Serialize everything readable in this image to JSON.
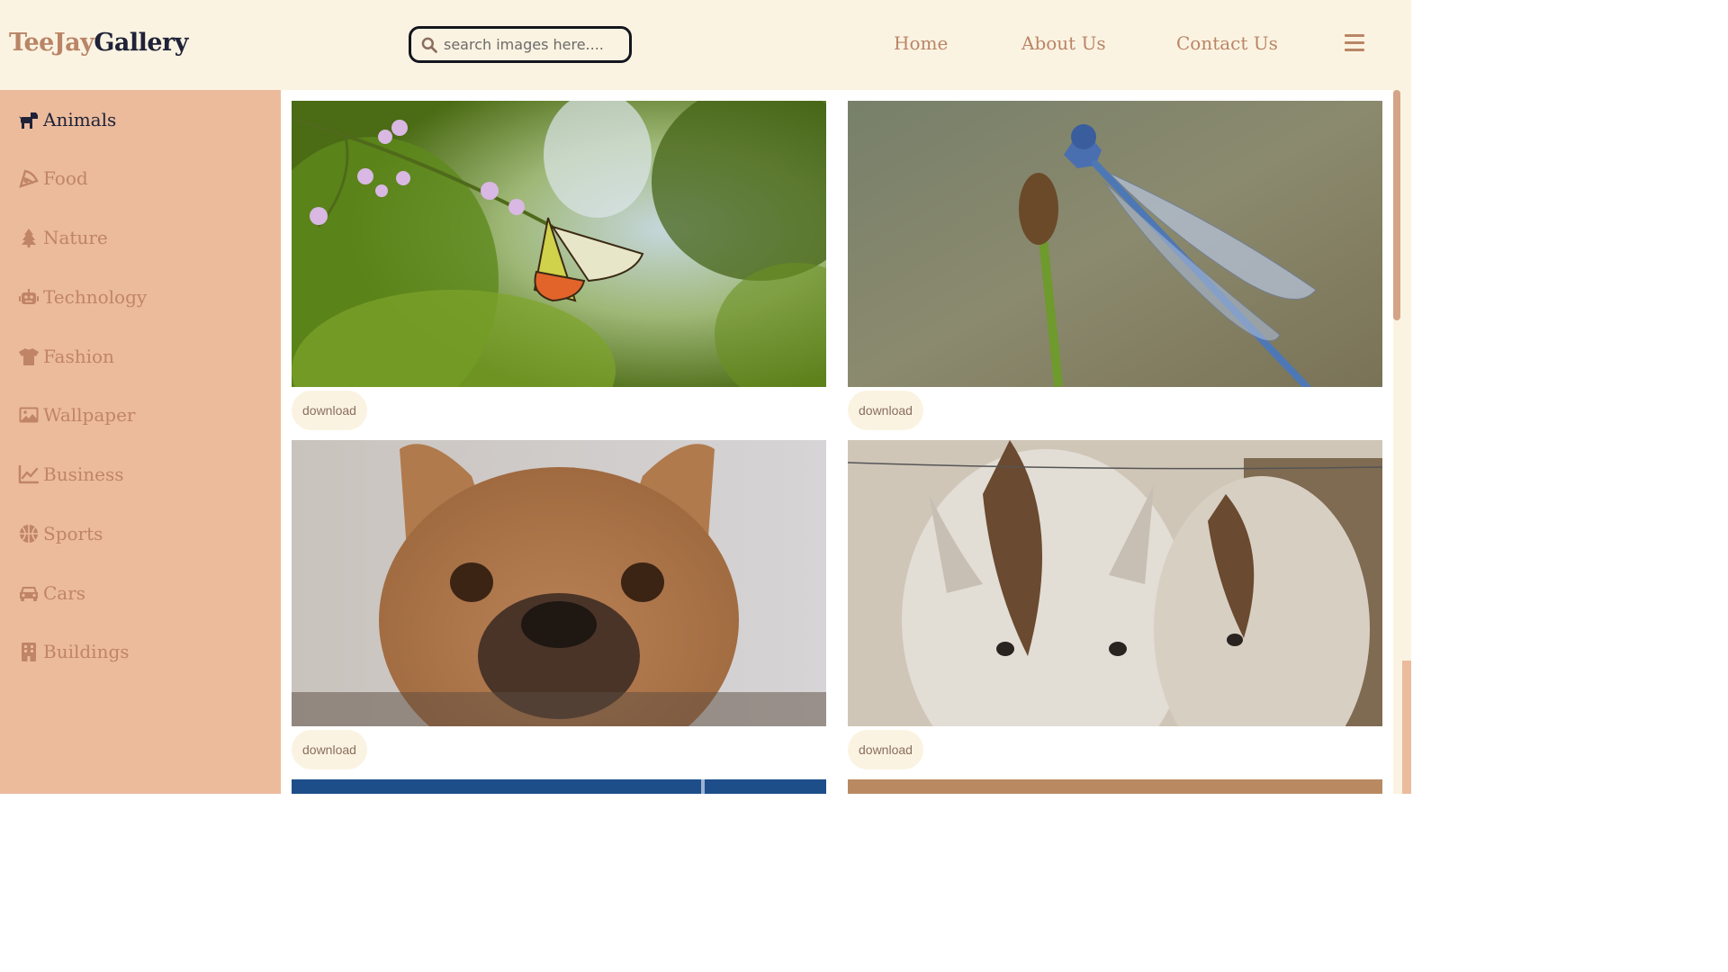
{
  "brand": {
    "part1": "TeeJay",
    "part2": "Gallery"
  },
  "search": {
    "placeholder": "search images here...."
  },
  "nav": {
    "items": [
      "Home",
      "About Us",
      "Contact Us"
    ]
  },
  "sidebar": {
    "items": [
      {
        "label": "Animals",
        "icon": "dog-icon",
        "active": true
      },
      {
        "label": "Food",
        "icon": "pizza-icon",
        "active": false
      },
      {
        "label": "Nature",
        "icon": "tree-icon",
        "active": false
      },
      {
        "label": "Technology",
        "icon": "robot-icon",
        "active": false
      },
      {
        "label": "Fashion",
        "icon": "shirt-icon",
        "active": false
      },
      {
        "label": "Wallpaper",
        "icon": "image-icon",
        "active": false
      },
      {
        "label": "Business",
        "icon": "chart-line-icon",
        "active": false
      },
      {
        "label": "Sports",
        "icon": "basketball-icon",
        "active": false
      },
      {
        "label": "Cars",
        "icon": "car-icon",
        "active": false
      },
      {
        "label": "Buildings",
        "icon": "building-icon",
        "active": false
      }
    ]
  },
  "gallery": {
    "download_label": "download",
    "images": [
      {
        "subject": "butterfly"
      },
      {
        "subject": "dragonfly"
      },
      {
        "subject": "french-bulldog"
      },
      {
        "subject": "horses"
      },
      {
        "subject": "blue-image"
      },
      {
        "subject": "tan-image"
      }
    ]
  },
  "colors": {
    "header_bg": "#fbf3e1",
    "sidebar_bg": "#ebbb9c",
    "accent": "#b98566",
    "brand_dark": "#1f2238",
    "button_bg": "#fbf3e1"
  }
}
